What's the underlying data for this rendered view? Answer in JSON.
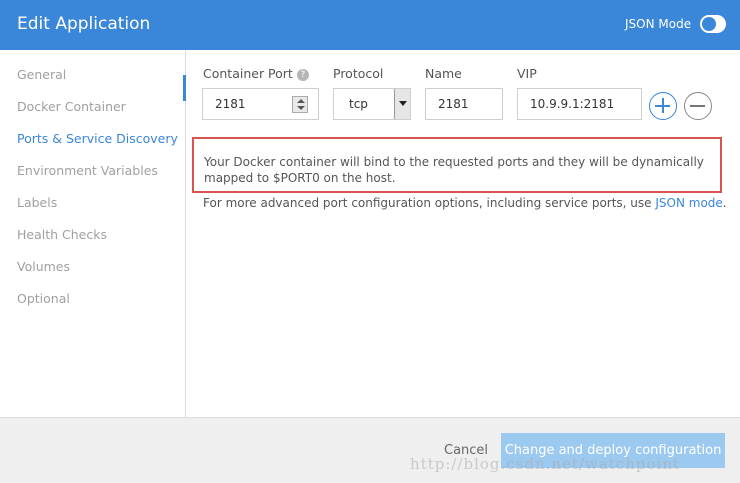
{
  "header": {
    "title": "Edit Application",
    "json_mode_label": "JSON Mode",
    "json_mode_on": false
  },
  "sidebar": {
    "items": [
      {
        "label": "General",
        "active": false
      },
      {
        "label": "Docker Container",
        "active": false
      },
      {
        "label": "Ports & Service Discovery",
        "active": true
      },
      {
        "label": "Environment Variables",
        "active": false
      },
      {
        "label": "Labels",
        "active": false
      },
      {
        "label": "Health Checks",
        "active": false
      },
      {
        "label": "Volumes",
        "active": false
      },
      {
        "label": "Optional",
        "active": false
      }
    ]
  },
  "form": {
    "container_port": {
      "label": "Container Port",
      "value": "2181"
    },
    "protocol": {
      "label": "Protocol",
      "value": "tcp"
    },
    "name": {
      "label": "Name",
      "value": "2181"
    },
    "vip": {
      "label": "VIP",
      "value": "10.9.9.1:2181"
    },
    "help_glyph": "?"
  },
  "notice": {
    "text": "Your Docker container will bind to the requested ports and they will be dynamically mapped to $PORT0 on the host."
  },
  "more_info": {
    "text": "For more advanced port configuration options, including service ports, use ",
    "link": "JSON mode",
    "suffix": "."
  },
  "footer": {
    "cancel_label": "Cancel",
    "deploy_label": "Change and deploy configuration"
  },
  "watermark": "http://blog.csdn.net/watchpoint",
  "colors": {
    "accent": "#3a86d8",
    "notice_border": "#d9534f",
    "deploy_button": "#9cc9f0"
  },
  "icons": {
    "add": "plus-circle-icon",
    "remove": "minus-circle-icon",
    "help": "question-circle-icon"
  }
}
